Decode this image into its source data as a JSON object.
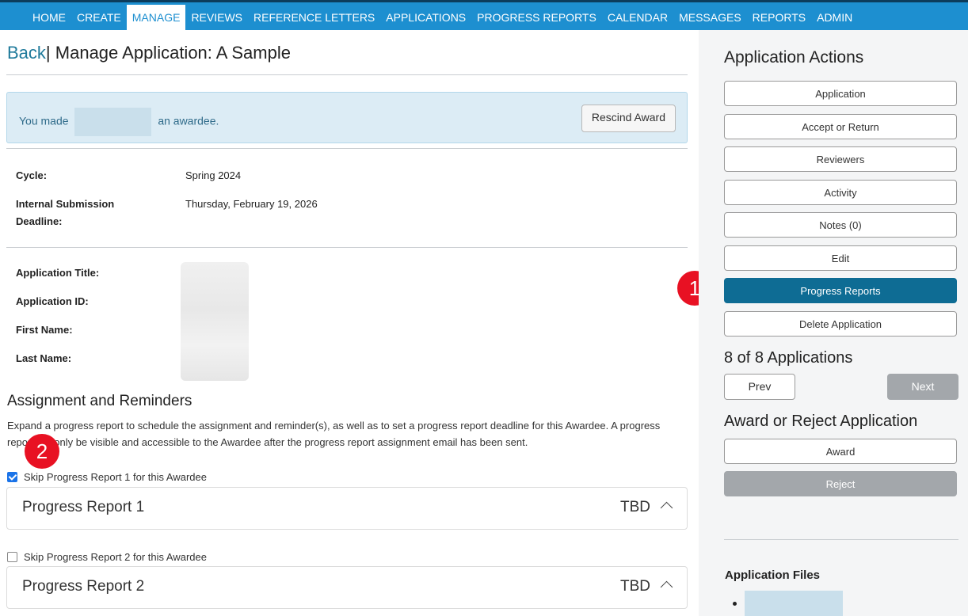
{
  "nav": {
    "items": [
      {
        "label": "HOME",
        "active": false
      },
      {
        "label": "CREATE",
        "active": false
      },
      {
        "label": "MANAGE",
        "active": true
      },
      {
        "label": "REVIEWS",
        "active": false
      },
      {
        "label": "REFERENCE LETTERS",
        "active": false
      },
      {
        "label": "APPLICATIONS",
        "active": false
      },
      {
        "label": "PROGRESS REPORTS",
        "active": false
      },
      {
        "label": "CALENDAR",
        "active": false
      },
      {
        "label": "MESSAGES",
        "active": false
      },
      {
        "label": "REPORTS",
        "active": false
      },
      {
        "label": "ADMIN",
        "active": false
      }
    ]
  },
  "header": {
    "back_label": "Back",
    "separator": "|",
    "title": "Manage Application: A Sample"
  },
  "alert": {
    "text_before": "You made",
    "text_after": "an awardee.",
    "rescind_label": "Rescind Award"
  },
  "details": {
    "cycle_label": "Cycle:",
    "cycle_value": "Spring 2024",
    "deadline_label_1": "Internal Submission",
    "deadline_label_2": "Deadline:",
    "deadline_value": "Thursday, February 19, 2026",
    "app_title_label": "Application Title:",
    "app_id_label": "Application ID:",
    "first_name_label": "First Name:",
    "last_name_label": "Last Name:"
  },
  "assignment": {
    "heading": "Assignment and Reminders",
    "description": "Expand a progress report to schedule the assignment and reminder(s), as well as to set a progress report deadline for this Awardee. A progress report will only be visible and accessible to the Awardee after the progress report assignment email has been sent.",
    "reports": [
      {
        "skip_label": "Skip Progress Report 1 for this Awardee",
        "skip_checked": true,
        "title": "Progress Report 1",
        "status": "TBD"
      },
      {
        "skip_label": "Skip Progress Report 2 for this Awardee",
        "skip_checked": false,
        "title": "Progress Report 2",
        "status": "TBD"
      }
    ]
  },
  "badges": {
    "one": "1",
    "two": "2",
    "color": "#e81123"
  },
  "sidebar": {
    "actions_heading": "Application Actions",
    "actions": [
      {
        "label": "Application"
      },
      {
        "label": "Accept or Return"
      },
      {
        "label": "Reviewers"
      },
      {
        "label": "Activity"
      },
      {
        "label": "Notes (0)"
      },
      {
        "label": "Edit"
      },
      {
        "label": "Progress Reports"
      },
      {
        "label": "Delete Application"
      }
    ],
    "count_heading": "8 of 8 Applications",
    "prev_label": "Prev",
    "next_label": "Next",
    "award_heading": "Award or Reject Application",
    "award_label": "Award",
    "reject_label": "Reject",
    "files_heading": "Application Files"
  },
  "colors": {
    "nav_bg": "#1d8fd0",
    "primary": "#0e6c94",
    "link": "#1f7a9b",
    "disabled": "#a3a7ab"
  }
}
